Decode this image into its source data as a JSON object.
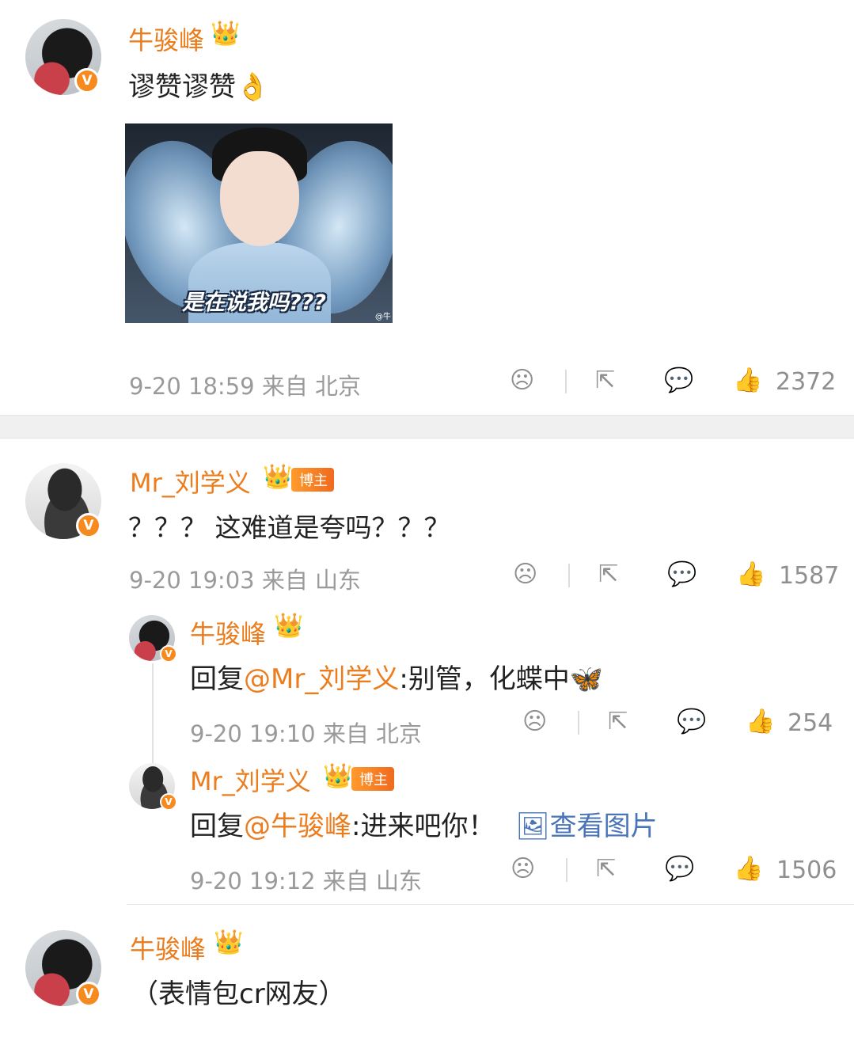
{
  "comments": [
    {
      "user": "牛骏峰",
      "text": "谬赞谬赞👌",
      "time": "9-20 18:59",
      "location": "来自 北京",
      "likes": "2372",
      "image": {
        "caption": "是在说我吗???",
        "watermark": "@牛"
      }
    },
    {
      "user": "Mr_刘学义",
      "tag": "博主",
      "text": "？？？ 这难道是夸吗？？？",
      "time": "9-20 19:03",
      "location": "来自 山东",
      "likes": "1587",
      "replies": [
        {
          "user": "牛骏峰",
          "prefix": "回复",
          "mention": "@Mr_刘学义",
          "text": ":别管，化蝶中🦋",
          "time": "9-20 19:10",
          "location": "来自 北京",
          "likes": "254"
        },
        {
          "user": "Mr_刘学义",
          "tag": "博主",
          "prefix": "回复",
          "mention": "@牛骏峰",
          "text": ":进来吧你！",
          "view_image": "查看图片",
          "time": "9-20 19:12",
          "location": "来自 山东",
          "likes": "1506"
        }
      ]
    },
    {
      "user": "牛骏峰",
      "text": "（表情包cr网友）"
    }
  ],
  "icons": {
    "dislike": "sad-face-icon",
    "share": "share-icon",
    "comment": "comment-icon",
    "like": "thumbs-up-icon",
    "crown": "crown-icon",
    "verified": "verified-badge-icon"
  },
  "badge": {
    "verified_letter": "V"
  },
  "colors": {
    "username": "#eb7d1e",
    "meta": "#9a9a9a",
    "tag_bg": "#f58322",
    "link": "#4a74b8"
  }
}
